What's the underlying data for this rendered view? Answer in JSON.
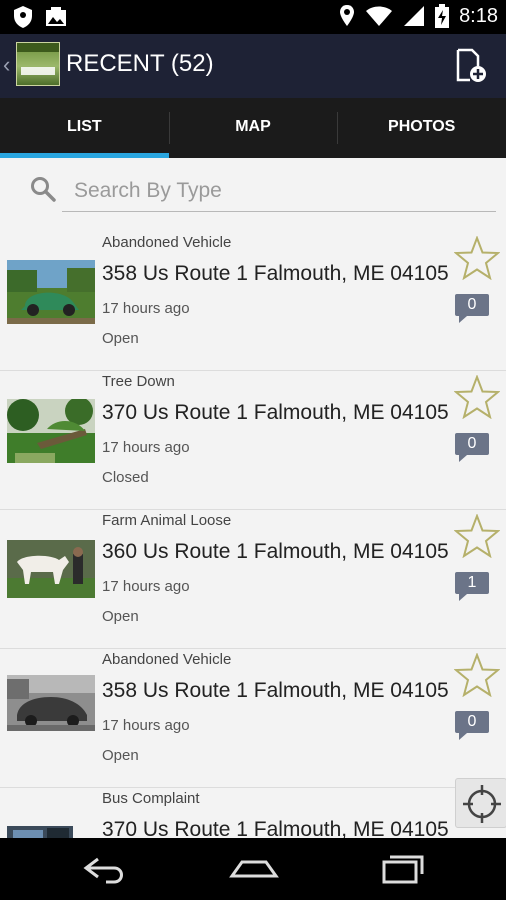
{
  "status_bar": {
    "time": "8:18",
    "icons": [
      "shield-icon",
      "image-notification-icon",
      "location-icon",
      "wifi-icon",
      "signal-icon",
      "battery-charging-icon"
    ]
  },
  "action_bar": {
    "title": "RECENT (52)",
    "back_icon": "chevron-left-icon",
    "action_icon": "add-report-icon"
  },
  "tabs": [
    {
      "label": "LIST",
      "active": true
    },
    {
      "label": "MAP",
      "active": false
    },
    {
      "label": "PHOTOS",
      "active": false
    }
  ],
  "search": {
    "placeholder": "Search By Type",
    "value": ""
  },
  "reports": [
    {
      "type": "Abandoned Vehicle",
      "address": "358 Us Route 1 Falmouth, ME 04105",
      "time": "17 hours ago",
      "status": "Open",
      "comments": "0"
    },
    {
      "type": "Tree Down",
      "address": "370 Us Route 1 Falmouth, ME 04105",
      "time": "17 hours ago",
      "status": "Closed",
      "comments": "0"
    },
    {
      "type": "Farm Animal Loose",
      "address": "360 Us Route 1 Falmouth, ME 04105",
      "time": "17 hours ago",
      "status": "Open",
      "comments": "1"
    },
    {
      "type": "Abandoned Vehicle",
      "address": "358 Us Route 1 Falmouth, ME 04105",
      "time": "17 hours ago",
      "status": "Open",
      "comments": "0"
    },
    {
      "type": "Bus Complaint",
      "address": "370 Us Route 1 Falmouth, ME 04105",
      "time": "",
      "status": "",
      "comments": ""
    }
  ],
  "colors": {
    "action_bar": "#1e2235",
    "tab_bar": "#1b1b1b",
    "tab_indicator": "#2aa6e0",
    "comment_badge": "#6b7488",
    "star_outline": "#b5b06a"
  }
}
